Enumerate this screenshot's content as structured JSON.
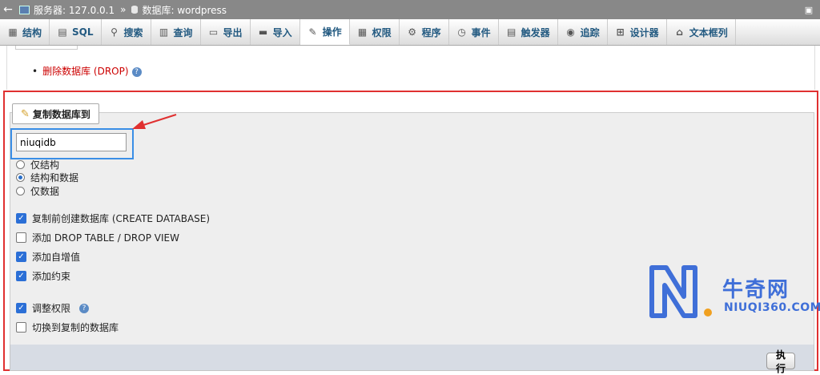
{
  "breadcrumb": {
    "server_label": "服务器: 127.0.0.1",
    "separator": "»",
    "database_label": "数据库: wordpress"
  },
  "tabs": [
    {
      "label": "结构",
      "icon": "structure-icon"
    },
    {
      "label": "SQL",
      "icon": "sql-icon"
    },
    {
      "label": "搜索",
      "icon": "search-icon"
    },
    {
      "label": "查询",
      "icon": "query-icon"
    },
    {
      "label": "导出",
      "icon": "export-icon"
    },
    {
      "label": "导入",
      "icon": "import-icon"
    },
    {
      "label": "操作",
      "icon": "wrench-icon",
      "active": true
    },
    {
      "label": "权限",
      "icon": "privileges-icon"
    },
    {
      "label": "程序",
      "icon": "routines-icon"
    },
    {
      "label": "事件",
      "icon": "clock-icon"
    },
    {
      "label": "触发器",
      "icon": "triggers-icon"
    },
    {
      "label": "追踪",
      "icon": "eye-icon"
    },
    {
      "label": "设计器",
      "icon": "designer-icon"
    },
    {
      "label": "文本框列",
      "icon": "columns-icon"
    }
  ],
  "drop": {
    "bullet": "•",
    "link_label": "删除数据库 (DROP)",
    "help": "?"
  },
  "copy": {
    "legend": "复制数据库到",
    "input_value": "niuqidb",
    "radios": [
      {
        "label": "仅结构",
        "checked": false
      },
      {
        "label": "结构和数据",
        "checked": true
      },
      {
        "label": "仅数据",
        "checked": false
      }
    ],
    "checks": [
      {
        "label": "复制前创建数据库 (CREATE DATABASE)",
        "checked": true
      },
      {
        "label": "添加 DROP TABLE / DROP VIEW",
        "checked": false
      },
      {
        "label": "添加自增值",
        "checked": true
      },
      {
        "label": "添加约束",
        "checked": true
      },
      {
        "label": "调整权限",
        "checked": true
      },
      {
        "label": "切换到复制的数据库",
        "checked": false
      }
    ],
    "help": "?",
    "execute_label": "执行"
  },
  "watermark": {
    "brand": "牛奇网",
    "domain": "NIUQI360.COM"
  },
  "colors": {
    "highlight_red": "#e03030",
    "highlight_blue": "#3a8ee6",
    "drop_link": "#cc0000",
    "brand_blue": "#3f6fd8"
  }
}
